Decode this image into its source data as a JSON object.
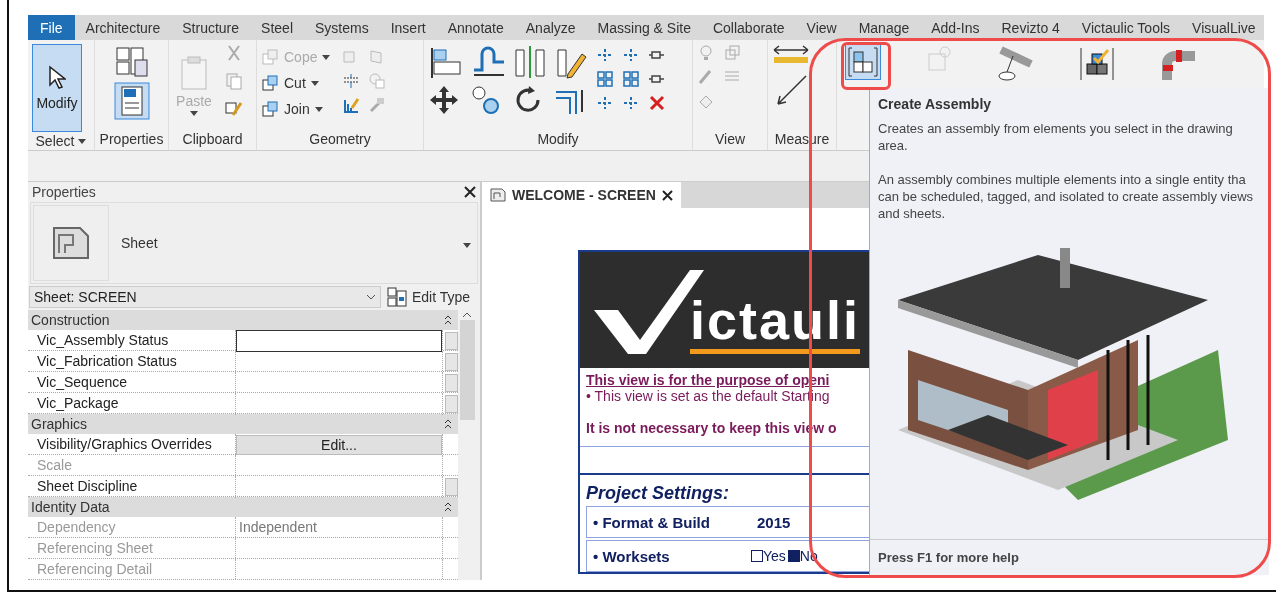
{
  "menu_tabs": [
    {
      "label": "File",
      "selected": true
    },
    {
      "label": "Architecture",
      "selected": false
    },
    {
      "label": "Structure",
      "selected": false
    },
    {
      "label": "Steel",
      "selected": false
    },
    {
      "label": "Systems",
      "selected": false
    },
    {
      "label": "Insert",
      "selected": false
    },
    {
      "label": "Annotate",
      "selected": false
    },
    {
      "label": "Analyze",
      "selected": false
    },
    {
      "label": "Massing & Site",
      "selected": false
    },
    {
      "label": "Collaborate",
      "selected": false
    },
    {
      "label": "View",
      "selected": false
    },
    {
      "label": "Manage",
      "selected": false
    },
    {
      "label": "Add-Ins",
      "selected": false
    },
    {
      "label": "Revizto 4",
      "selected": false
    },
    {
      "label": "Victaulic Tools",
      "selected": false
    },
    {
      "label": "VisualLive",
      "selected": false
    }
  ],
  "ribbon": {
    "panels": [
      {
        "kind": "select",
        "label": "Select",
        "tools": [
          {
            "label": "Modify",
            "selected": true
          }
        ]
      },
      {
        "kind": "properties",
        "label": "Properties"
      },
      {
        "kind": "clipboard",
        "label": "Clipboard",
        "tools": [
          {
            "label": "Paste",
            "disabled": true
          }
        ]
      },
      {
        "kind": "geometry",
        "label": "Geometry",
        "tools": [
          {
            "label": "Cope",
            "disabled": true
          },
          {
            "label": "Cut",
            "disabled": false
          },
          {
            "label": "Join",
            "disabled": false
          }
        ]
      },
      {
        "kind": "modify",
        "label": "Modify"
      },
      {
        "kind": "view",
        "label": "View"
      },
      {
        "kind": "measure",
        "label": "Measure"
      },
      {
        "kind": "assembly",
        "tools": [
          {
            "selected": true
          }
        ]
      }
    ]
  },
  "properties": {
    "title": "Properties",
    "type_name": "Sheet",
    "instance": "Sheet: SCREEN",
    "edit_type": "Edit Type",
    "groups": [
      {
        "name": "Construction",
        "expanded": true,
        "rows": [
          {
            "label": "Vic_Assembly Status",
            "kind": "field",
            "disabled": false,
            "has_button": true
          },
          {
            "label": "Vic_Fabrication Status",
            "kind": "empty",
            "disabled": false,
            "has_button": true
          },
          {
            "label": "Vic_Sequence",
            "kind": "empty",
            "disabled": false,
            "has_button": true
          },
          {
            "label": "Vic_Package",
            "kind": "empty",
            "disabled": false,
            "has_button": true
          }
        ]
      },
      {
        "name": "Graphics",
        "expanded": true,
        "rows": [
          {
            "label": "Visibility/Graphics Overrides",
            "kind": "button",
            "value": "Edit...",
            "disabled": false,
            "has_button": false
          },
          {
            "label": "Scale",
            "kind": "empty",
            "disabled": true,
            "has_button": false
          },
          {
            "label": "Sheet Discipline",
            "kind": "empty",
            "disabled": false,
            "has_button": true
          }
        ]
      },
      {
        "name": "Identity Data",
        "expanded": true,
        "rows": [
          {
            "label": "Dependency",
            "kind": "text",
            "value": "Independent",
            "disabled": true,
            "has_button": false
          },
          {
            "label": "Referencing Sheet",
            "kind": "empty",
            "disabled": true,
            "has_button": false
          },
          {
            "label": "Referencing Detail",
            "kind": "empty",
            "disabled": true,
            "has_button": false
          }
        ]
      }
    ]
  },
  "view_tab": {
    "title": "WELCOME - SCREEN"
  },
  "sheet": {
    "logo_text": "ictauli",
    "notice_link": "This view is for the purpose of openi",
    "notice_bullet": "• This view is set as the default Starting",
    "notice_bold": "It is not necessary to keep this view o",
    "settings_title": "Project Settings:",
    "settings": [
      {
        "kind": "text",
        "label": "• Format & Build",
        "value": "2015"
      },
      {
        "kind": "yes_no",
        "label": "• Worksets",
        "options": [
          {
            "label": "Yes",
            "checked": false
          },
          {
            "label": "No",
            "checked": true
          }
        ]
      }
    ]
  },
  "tooltip": {
    "title": "Create Assembly",
    "description": "Creates an assembly from elements you select in the drawing area.",
    "details": [
      "An assembly combines multiple elements into a single entity tha",
      "can be scheduled, tagged, and isolated to create assembly views",
      "and sheets."
    ],
    "footer": "Press F1 for more help"
  }
}
